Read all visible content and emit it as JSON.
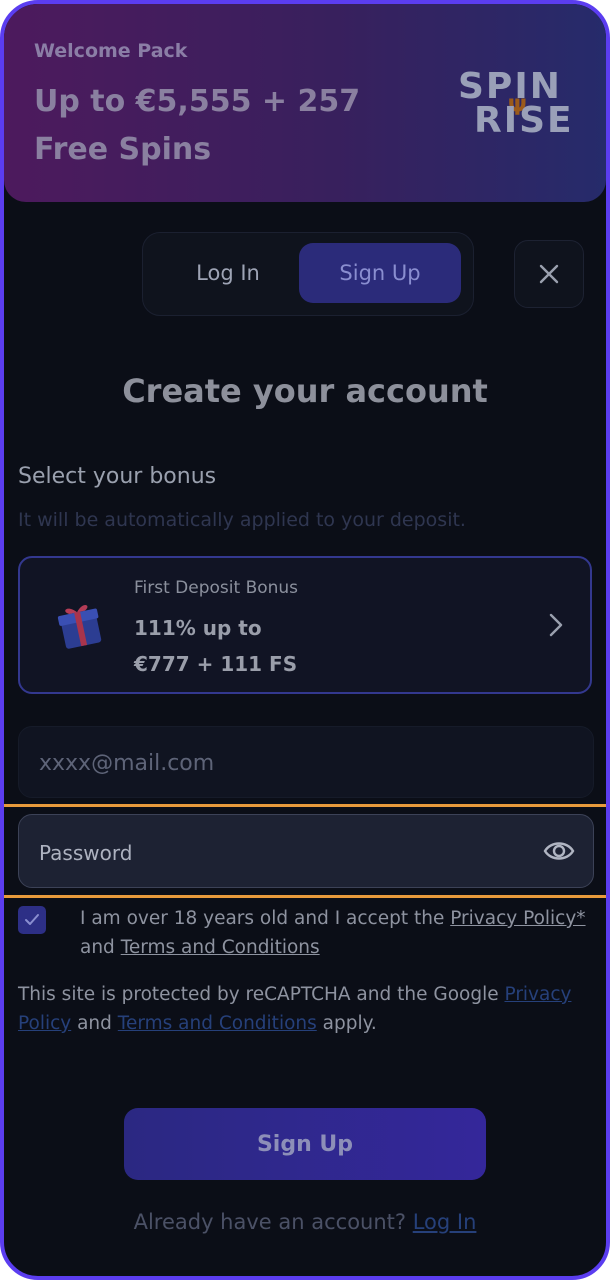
{
  "banner": {
    "eyebrow": "Welcome Pack",
    "offer": "Up to €5,555 + 257 Free Spins",
    "logo_line1": "SPIN",
    "logo_line2": "RISE"
  },
  "tabs": {
    "login_label": "Log In",
    "signup_label": "Sign Up",
    "active": "Sign Up"
  },
  "close_icon": "close-icon",
  "title": "Create your account",
  "bonus": {
    "heading": "Select your bonus",
    "subheading": "It will be automatically applied to your deposit.",
    "card": {
      "label": "First Deposit Bonus",
      "line1": "111% up to",
      "line2": "€777 + 111 FS",
      "icon": "gift-icon"
    }
  },
  "form": {
    "email_value": "xxxx@mail.com",
    "password_placeholder": "Password",
    "terms_text_a": "I am over 18 years old and I accept the ",
    "privacy_link": "Privacy Policy*",
    "terms_text_b": " and ",
    "terms_link": "Terms and Conditions",
    "terms_checked": true
  },
  "recaptcha": {
    "text_a": "This site is protected by reCAPTCHA and the Google ",
    "privacy_link": "Privacy Policy",
    "text_b": " and ",
    "terms_link": "Terms and Conditions",
    "text_c": " apply."
  },
  "submit_label": "Sign Up",
  "footer": {
    "text": "Already have an account? ",
    "link": "Log In"
  },
  "colors": {
    "accent": "#2b2b7a",
    "highlight_line": "#e79a3c",
    "frame_border": "#5b3df0"
  }
}
